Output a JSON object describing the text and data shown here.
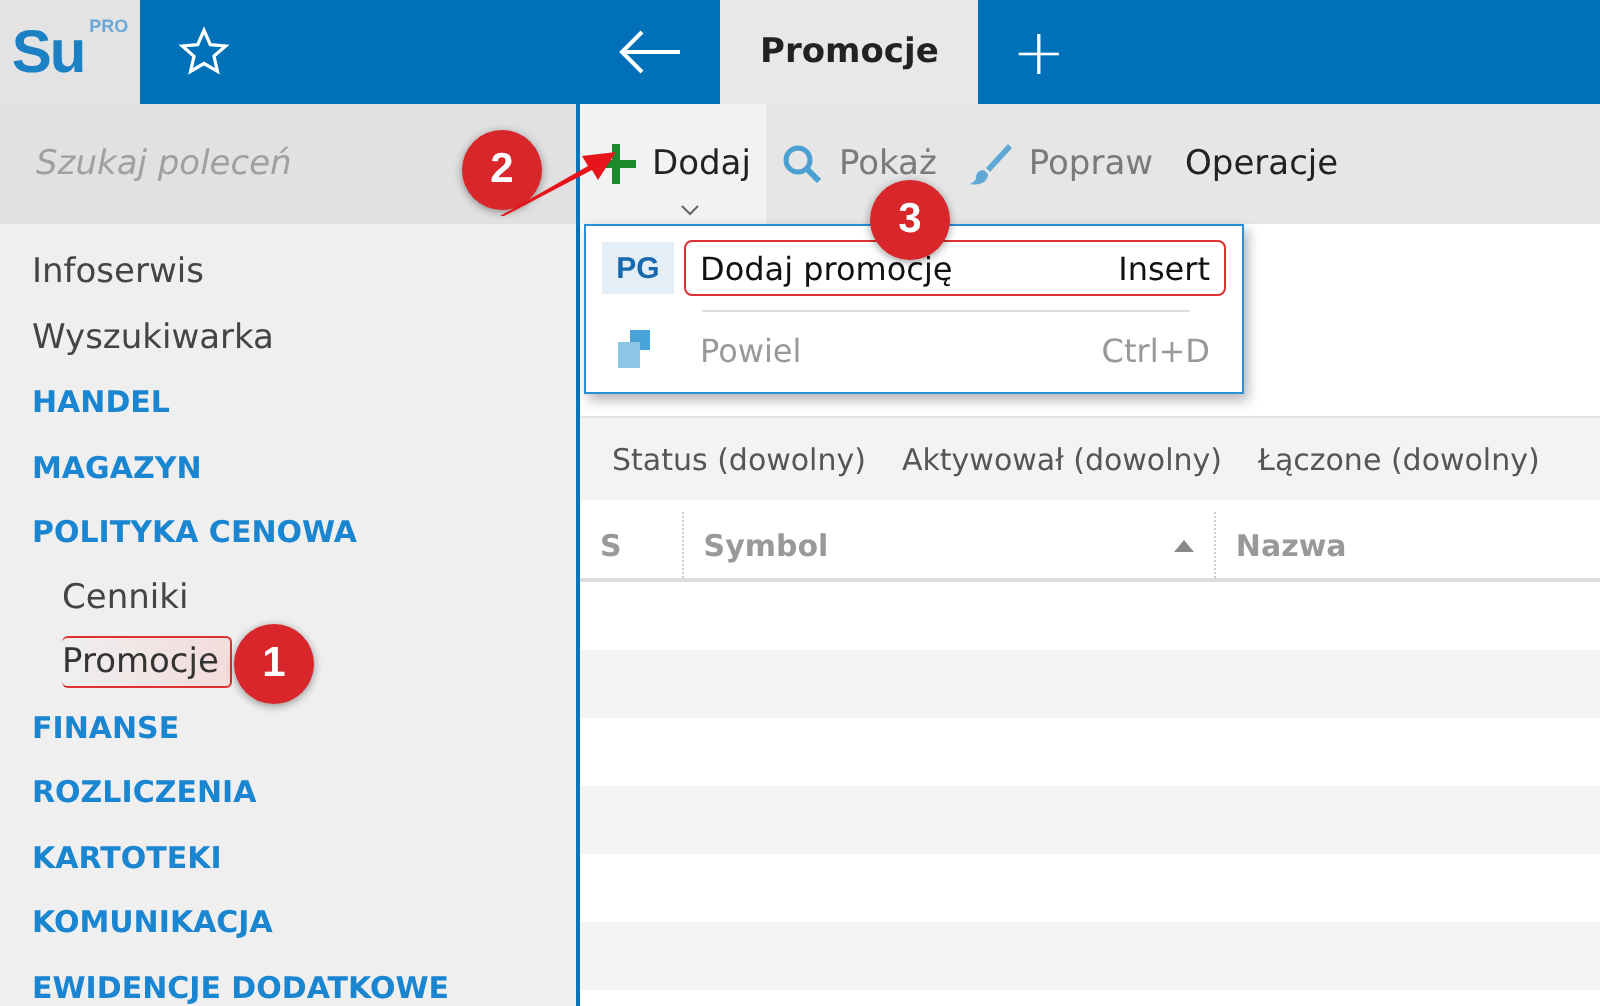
{
  "app": {
    "logo": "Su",
    "logo_badge": "PRO"
  },
  "tabs": [
    {
      "label": "Promocje",
      "selected": true
    }
  ],
  "add_tab": "+",
  "search": {
    "placeholder": "Szukaj poleceń"
  },
  "sidebar": {
    "items": [
      {
        "label": "Infoserwis",
        "kind": "link"
      },
      {
        "label": "Wyszukiwarka",
        "kind": "link"
      },
      {
        "label": "HANDEL",
        "kind": "section"
      },
      {
        "label": "MAGAZYN",
        "kind": "section"
      },
      {
        "label": "POLITYKA CENOWA",
        "kind": "section",
        "children": [
          {
            "label": "Cenniki",
            "selected": false,
            "highlighted": false
          },
          {
            "label": "Promocje",
            "selected": true,
            "highlighted": true,
            "callout": "1"
          }
        ]
      },
      {
        "label": "FINANSE",
        "kind": "section"
      },
      {
        "label": "ROZLICZENIA",
        "kind": "section"
      },
      {
        "label": "KARTOTEKI",
        "kind": "section"
      },
      {
        "label": "KOMUNIKACJA",
        "kind": "section"
      },
      {
        "label": "EWIDENCJE DODATKOWE",
        "kind": "section"
      }
    ]
  },
  "toolbar": [
    {
      "label": "Dodaj",
      "kind": "add",
      "disabled": false,
      "open": true
    },
    {
      "label": "Pokaż",
      "kind": "search",
      "disabled": true,
      "open": false
    },
    {
      "label": "Popraw",
      "kind": "edit",
      "disabled": true,
      "open": false
    },
    {
      "label": "Operacje",
      "kind": "text",
      "disabled": false,
      "open": false
    }
  ],
  "search_callout": "2",
  "toolbar_callout": "3",
  "menu": [
    {
      "icon_text": "PG",
      "label": "Dodaj promocję",
      "shortcut": "Insert",
      "disabled": false,
      "highlighted": true
    },
    {
      "label": "Powiel",
      "shortcut": "Ctrl+D",
      "disabled": true,
      "highlighted": false
    }
  ],
  "filters": [
    "Status (dowolny)",
    "Aktywował (dowolny)",
    "Łączone (dowolny)"
  ],
  "table": {
    "columns": [
      {
        "label": "S",
        "sorted": false
      },
      {
        "label": "Symbol",
        "sorted": true
      },
      {
        "label": "Nazwa",
        "sorted": false
      }
    ]
  }
}
